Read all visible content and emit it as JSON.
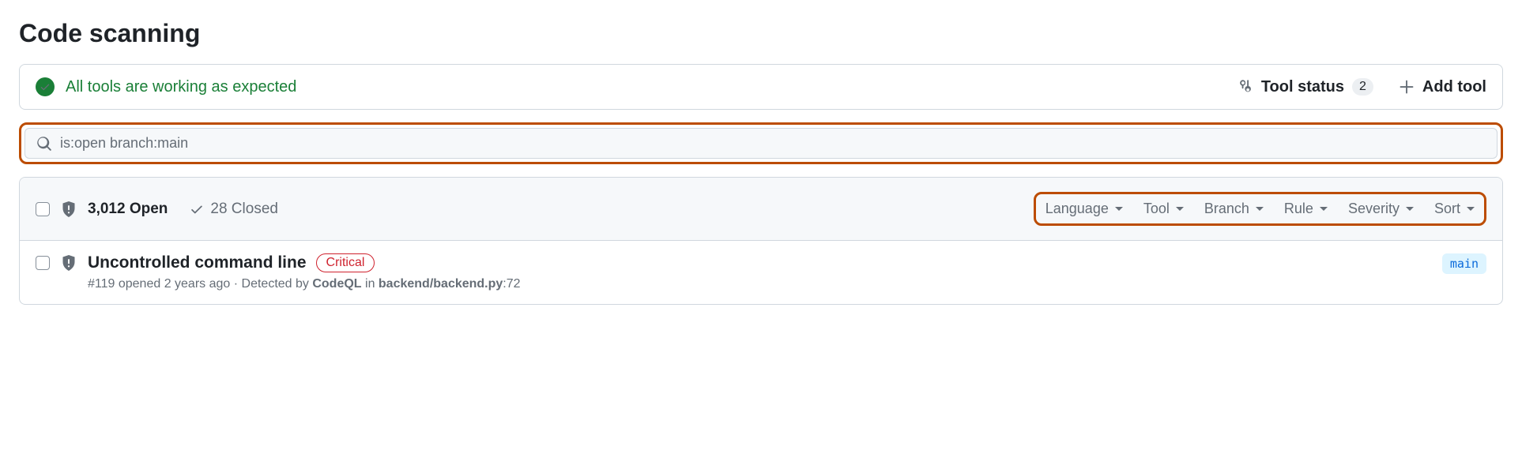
{
  "page_title": "Code scanning",
  "status_bar": {
    "message": "All tools are working as expected",
    "tool_status_label": "Tool status",
    "tool_status_count": "2",
    "add_tool_label": "Add tool"
  },
  "search": {
    "value": "is:open branch:main"
  },
  "counts": {
    "open_label": "3,012 Open",
    "closed_label": "28 Closed"
  },
  "filters": {
    "language": "Language",
    "tool": "Tool",
    "branch": "Branch",
    "rule": "Rule",
    "severity": "Severity",
    "sort": "Sort"
  },
  "alert": {
    "title": "Uncontrolled command line",
    "severity": "Critical",
    "meta_prefix": "#119 opened 2 years ago · Detected by ",
    "tool": "CodeQL",
    "meta_mid": " in ",
    "file": "backend/backend.py",
    "line_suffix": ":72",
    "branch": "main"
  }
}
